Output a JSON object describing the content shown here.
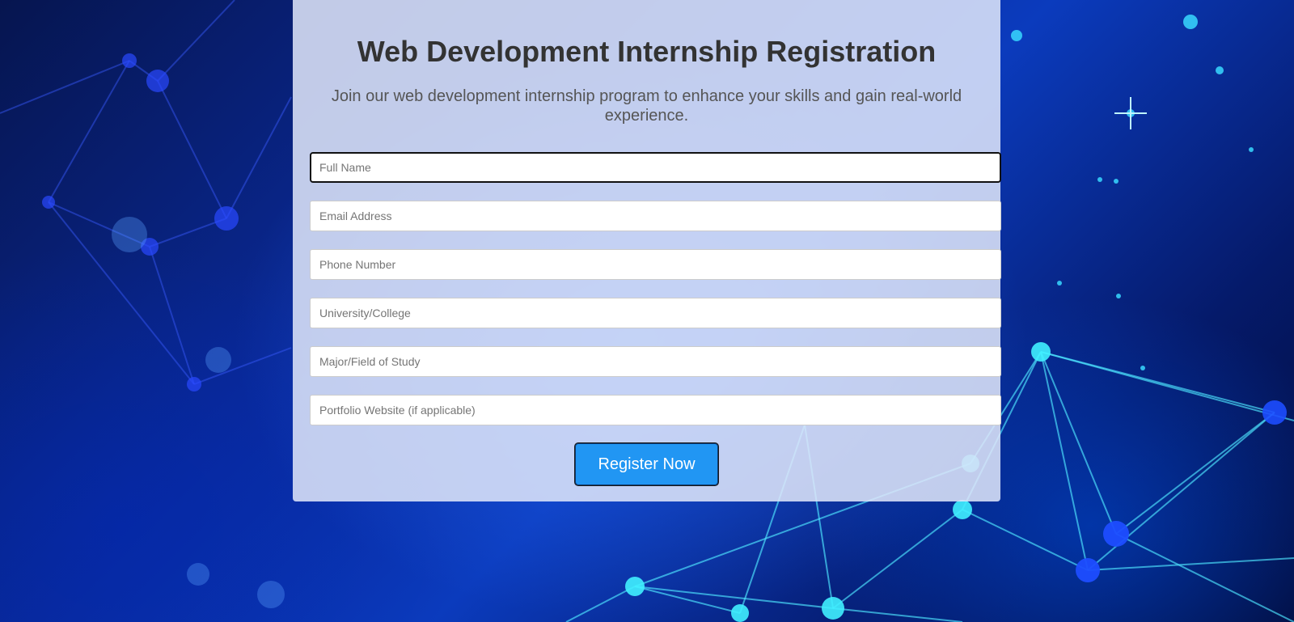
{
  "form": {
    "title": "Web Development Internship Registration",
    "subtitle": "Join our web development internship program to enhance your skills and gain real-world experience.",
    "fields": [
      {
        "placeholder": "Full Name",
        "value": ""
      },
      {
        "placeholder": "Email Address",
        "value": ""
      },
      {
        "placeholder": "Phone Number",
        "value": ""
      },
      {
        "placeholder": "University/College",
        "value": ""
      },
      {
        "placeholder": "Major/Field of Study",
        "value": ""
      },
      {
        "placeholder": "Portfolio Website (if applicable)",
        "value": ""
      }
    ],
    "submit_label": "Register Now"
  },
  "colors": {
    "button": "#2196f3",
    "card": "#e1e8fa",
    "background": "#0a2a9a"
  }
}
